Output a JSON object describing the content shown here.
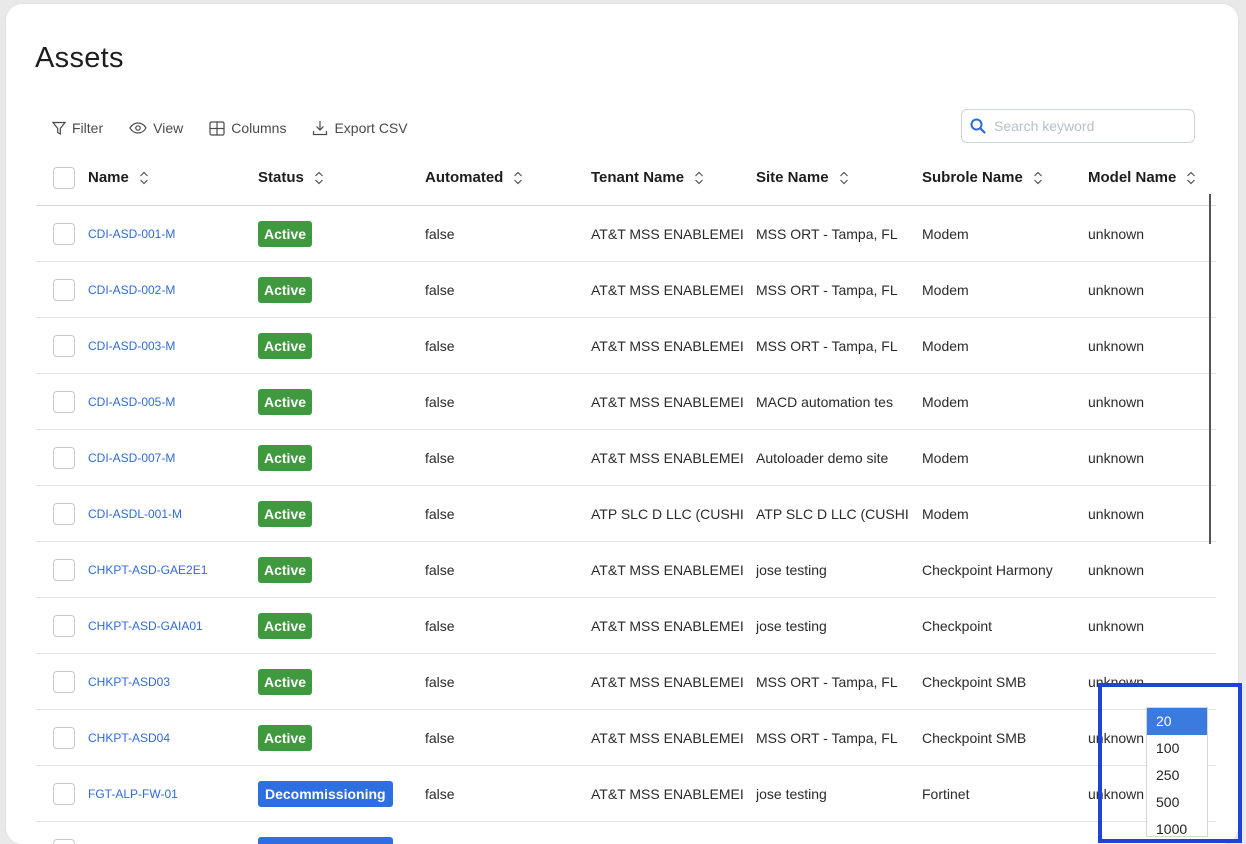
{
  "page": {
    "title": "Assets"
  },
  "toolbar": {
    "filter_label": "Filter",
    "view_label": "View",
    "columns_label": "Columns",
    "export_label": "Export CSV",
    "search_placeholder": "Search keyword"
  },
  "table": {
    "columns": [
      "Name",
      "Status",
      "Automated",
      "Tenant Name",
      "Site Name",
      "Subrole Name",
      "Model Name"
    ],
    "rows": [
      {
        "name": "CDI-ASD-001-M",
        "status": "Active",
        "automated": "false",
        "tenant": "AT&T MSS ENABLEMEI",
        "site": "MSS ORT - Tampa, FL",
        "subrole": "Modem",
        "model": "unknown"
      },
      {
        "name": "CDI-ASD-002-M",
        "status": "Active",
        "automated": "false",
        "tenant": "AT&T MSS ENABLEMEI",
        "site": "MSS ORT - Tampa, FL",
        "subrole": "Modem",
        "model": "unknown"
      },
      {
        "name": "CDI-ASD-003-M",
        "status": "Active",
        "automated": "false",
        "tenant": "AT&T MSS ENABLEMEI",
        "site": "MSS ORT - Tampa, FL",
        "subrole": "Modem",
        "model": "unknown"
      },
      {
        "name": "CDI-ASD-005-M",
        "status": "Active",
        "automated": "false",
        "tenant": "AT&T MSS ENABLEMEI",
        "site": "MACD automation tes",
        "subrole": "Modem",
        "model": "unknown"
      },
      {
        "name": "CDI-ASD-007-M",
        "status": "Active",
        "automated": "false",
        "tenant": "AT&T MSS ENABLEMEI",
        "site": "Autoloader demo site",
        "subrole": "Modem",
        "model": "unknown"
      },
      {
        "name": "CDI-ASDL-001-M",
        "status": "Active",
        "automated": "false",
        "tenant": "ATP SLC D LLC (CUSHI",
        "site": "ATP SLC D LLC (CUSHI",
        "subrole": "Modem",
        "model": "unknown"
      },
      {
        "name": "CHKPT-ASD-GAE2E1",
        "status": "Active",
        "automated": "false",
        "tenant": "AT&T MSS ENABLEMEI",
        "site": "jose testing",
        "subrole": "Checkpoint Harmony",
        "model": "unknown"
      },
      {
        "name": "CHKPT-ASD-GAIA01",
        "status": "Active",
        "automated": "false",
        "tenant": "AT&T MSS ENABLEMEI",
        "site": "jose testing",
        "subrole": "Checkpoint",
        "model": "unknown"
      },
      {
        "name": "CHKPT-ASD03",
        "status": "Active",
        "automated": "false",
        "tenant": "AT&T MSS ENABLEMEI",
        "site": "MSS ORT - Tampa, FL",
        "subrole": "Checkpoint SMB",
        "model": "unknown"
      },
      {
        "name": "CHKPT-ASD04",
        "status": "Active",
        "automated": "false",
        "tenant": "AT&T MSS ENABLEMEI",
        "site": "MSS ORT - Tampa, FL",
        "subrole": "Checkpoint SMB",
        "model": "unknown"
      },
      {
        "name": "FGT-ALP-FW-01",
        "status": "Decommissioning",
        "automated": "false",
        "tenant": "AT&T MSS ENABLEMEI",
        "site": "jose testing",
        "subrole": "Fortinet",
        "model": "unknown"
      },
      {
        "name": "",
        "status": "Decommissioning",
        "automated": "",
        "tenant": "",
        "site": "",
        "subrole": "",
        "model": ""
      }
    ]
  },
  "page_size": {
    "options": [
      "20",
      "100",
      "250",
      "500",
      "1000"
    ],
    "selected": "20"
  },
  "colors": {
    "active_badge": "#3f9a3f",
    "decommissioning_badge": "#2d6fe0",
    "link": "#2f6ad9",
    "highlight_box": "#1f43d8"
  }
}
